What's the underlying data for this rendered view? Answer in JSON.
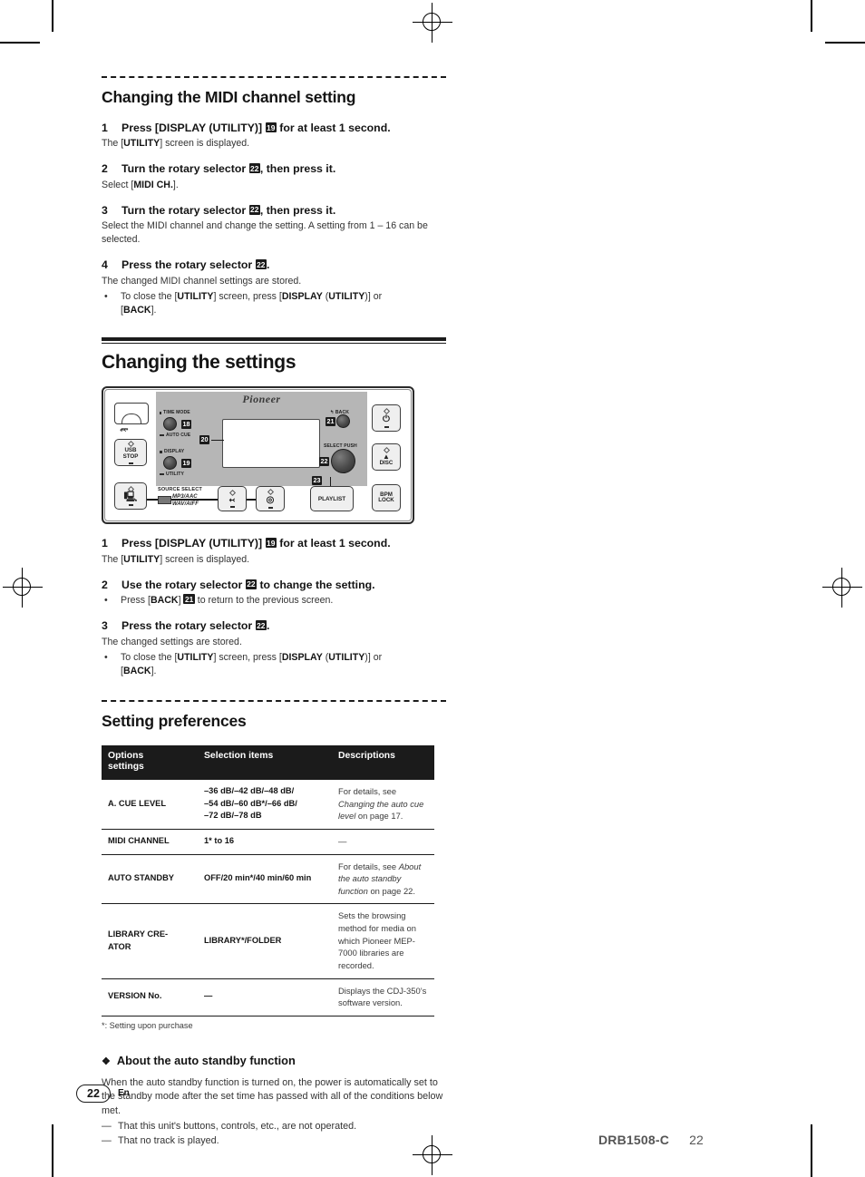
{
  "document": {
    "title": "Changing the MIDI channel setting",
    "device_model": "CDJ-350"
  },
  "section_midi": {
    "heading": "Changing the MIDI channel setting",
    "steps": [
      {
        "num": "1",
        "text_before": "Press [DISPLAY (UTILITY)]",
        "chip": "19",
        "text_after": "for at least 1 second.",
        "detail_prefix": "The [",
        "detail_bold": "UTILITY",
        "detail_suffix": "] screen is displayed."
      },
      {
        "num": "2",
        "text_before": "Turn the rotary selector",
        "chip": "22",
        "text_after": ", then press it.",
        "detail_prefix": "Select [",
        "detail_bold": "MIDI CH.",
        "detail_suffix": "]."
      },
      {
        "num": "3",
        "text_before": "Turn the rotary selector",
        "chip": "22",
        "text_after": ", then press it.",
        "detail_plain": "Select the MIDI channel and change the setting. A setting from 1 – 16 can be selected."
      },
      {
        "num": "4",
        "text_before": "Press the rotary selector",
        "chip": "22",
        "text_after": ".",
        "detail_plain": "The changed MIDI channel settings are stored.",
        "bullet_1": "To close the [UTILITY] screen, press [DISPLAY (UTILITY)] or [BACK]."
      }
    ]
  },
  "section_settings": {
    "heading": "Changing the settings",
    "steps": [
      {
        "num": "1",
        "text_before": "Press [DISPLAY (UTILITY)]",
        "chip": "19",
        "text_after": "for at least 1 second.",
        "detail_prefix": "The [",
        "detail_bold": "UTILITY",
        "detail_suffix": "] screen is displayed."
      },
      {
        "num": "2",
        "text_before": "Use the rotary selector",
        "chip": "22",
        "text_after": "to change the setting.",
        "bullet_prefix": "Press [",
        "bullet_bold": "BACK",
        "bullet_chip": "21",
        "bullet_suffix": "to return to the previous screen."
      },
      {
        "num": "3",
        "text_before": "Press the rotary selector",
        "chip": "22",
        "text_after": ".",
        "detail_plain": "The changed settings are stored.",
        "bullet_1": "To close the [UTILITY] screen, press [DISPLAY (UTILITY)] or [BACK]."
      }
    ]
  },
  "device": {
    "brand": "Pioneer",
    "labels": {
      "time_mode": "TIME MODE",
      "auto_cue": "AUTO CUE",
      "display": "DISPLAY",
      "utility": "UTILITY",
      "back": "BACK",
      "select_push": "SELECT PUSH",
      "source_select": "SOURCE SELECT",
      "formats_line1": "MP3/AAC",
      "formats_line2": "WAV/AIFF"
    },
    "buttons": {
      "usb_stop": "USB\nSTOP",
      "usb_stop_l1": "USB",
      "usb_stop_l2": "STOP",
      "playlist": "PLAYLIST",
      "power": "power-symbol",
      "disc_eject_l1": "DISC",
      "bpm_lock_l1": "BPM",
      "bpm_lock_l2": "LOCK"
    },
    "callouts": [
      "18",
      "19",
      "20",
      "21",
      "22",
      "23"
    ]
  },
  "section_preferences": {
    "heading": "Setting preferences",
    "table": {
      "headers": [
        "Options settings",
        "Selection items",
        "Descriptions"
      ],
      "header_line1": "Options",
      "header_line2": "settings",
      "rows": [
        {
          "option": "A. CUE LEVEL",
          "selection": "–36 dB/–42 dB/–48 dB/\n–54 dB/–60 dB*/–66 dB/\n–72 dB/–78 dB",
          "selection_l1": "–36 dB/–42 dB/–48 dB/",
          "selection_l2": "–54 dB/–60 dB*/–66 dB/",
          "selection_l3": "–72 dB/–78 dB",
          "desc_plain": "For details, see ",
          "desc_italic": "Changing the auto cue level",
          "desc_tail": " on page 17."
        },
        {
          "option": "MIDI CHANNEL",
          "selection_l1": "1* to 16",
          "desc_plain": "—"
        },
        {
          "option": "AUTO STANDBY",
          "selection_l1": "OFF/20 min*/40 min/60 min",
          "desc_plain": "For details, see ",
          "desc_italic": "About the auto standby function",
          "desc_tail": " on page 22."
        },
        {
          "option": "LIBRARY CRE-ATOR",
          "option_l1": "LIBRARY CRE-",
          "option_l2": "ATOR",
          "selection_l1": "LIBRARY*/FOLDER",
          "desc_plain": "Sets the browsing method for media on which Pioneer MEP-7000 libraries are recorded."
        },
        {
          "option": "VERSION No.",
          "selection_l1": "—",
          "desc_plain": "Displays the CDJ-350’s software version."
        }
      ],
      "note": "*: Setting upon purchase"
    }
  },
  "section_standby": {
    "glyph": "❖",
    "heading": "About the auto standby function",
    "paragraph": "When the auto standby function is turned on, the power is automatically set to the standby mode after the set time has passed with all of the conditions below met.",
    "items": [
      "That this unit's buttons, controls, etc., are not operated.",
      "That no track is played."
    ],
    "dash": "—"
  },
  "footer": {
    "page_number": "22",
    "language": "En",
    "doc_code": "DRB1508-C",
    "page_right": "22"
  }
}
